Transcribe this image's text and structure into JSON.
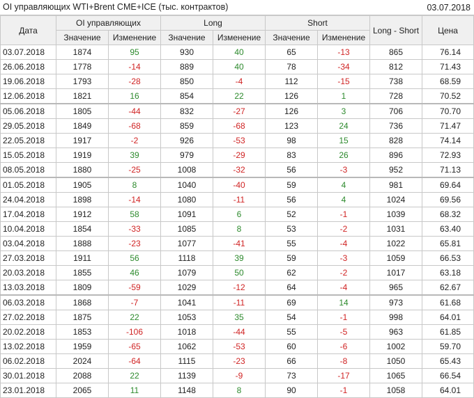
{
  "header": {
    "title": "OI управляющих WTI+Brent CME+ICE (тыс. контрактов)",
    "date": "03.07.2018"
  },
  "columns": {
    "date": "Дата",
    "oi_group": "OI управляющих",
    "long_group": "Long",
    "short_group": "Short",
    "value": "Значение",
    "change": "Изменение",
    "long_short": "Long - Short",
    "price": "Цена"
  },
  "colors": {
    "positive": "#2d8a2d",
    "negative": "#d02424"
  },
  "rows": [
    {
      "date": "03.07.2018",
      "oi": "1874",
      "oi_chg": "95",
      "long": "930",
      "long_chg": "40",
      "short": "65",
      "short_chg": "-13",
      "ls": "865",
      "price": "76.14"
    },
    {
      "date": "26.06.2018",
      "oi": "1778",
      "oi_chg": "-14",
      "long": "889",
      "long_chg": "40",
      "short": "78",
      "short_chg": "-34",
      "ls": "812",
      "price": "71.43"
    },
    {
      "date": "19.06.2018",
      "oi": "1793",
      "oi_chg": "-28",
      "long": "850",
      "long_chg": "-4",
      "short": "112",
      "short_chg": "-15",
      "ls": "738",
      "price": "68.59"
    },
    {
      "date": "12.06.2018",
      "oi": "1821",
      "oi_chg": "16",
      "long": "854",
      "long_chg": "22",
      "short": "126",
      "short_chg": "1",
      "ls": "728",
      "price": "70.52"
    },
    {
      "date": "05.06.2018",
      "oi": "1805",
      "oi_chg": "-44",
      "long": "832",
      "long_chg": "-27",
      "short": "126",
      "short_chg": "3",
      "ls": "706",
      "price": "70.70",
      "sep": true
    },
    {
      "date": "29.05.2018",
      "oi": "1849",
      "oi_chg": "-68",
      "long": "859",
      "long_chg": "-68",
      "short": "123",
      "short_chg": "24",
      "ls": "736",
      "price": "71.47"
    },
    {
      "date": "22.05.2018",
      "oi": "1917",
      "oi_chg": "-2",
      "long": "926",
      "long_chg": "-53",
      "short": "98",
      "short_chg": "15",
      "ls": "828",
      "price": "74.14"
    },
    {
      "date": "15.05.2018",
      "oi": "1919",
      "oi_chg": "39",
      "long": "979",
      "long_chg": "-29",
      "short": "83",
      "short_chg": "26",
      "ls": "896",
      "price": "72.93"
    },
    {
      "date": "08.05.2018",
      "oi": "1880",
      "oi_chg": "-25",
      "long": "1008",
      "long_chg": "-32",
      "short": "56",
      "short_chg": "-3",
      "ls": "952",
      "price": "71.13"
    },
    {
      "date": "01.05.2018",
      "oi": "1905",
      "oi_chg": "8",
      "long": "1040",
      "long_chg": "-40",
      "short": "59",
      "short_chg": "4",
      "ls": "981",
      "price": "69.64",
      "sep": true
    },
    {
      "date": "24.04.2018",
      "oi": "1898",
      "oi_chg": "-14",
      "long": "1080",
      "long_chg": "-11",
      "short": "56",
      "short_chg": "4",
      "ls": "1024",
      "price": "69.56"
    },
    {
      "date": "17.04.2018",
      "oi": "1912",
      "oi_chg": "58",
      "long": "1091",
      "long_chg": "6",
      "short": "52",
      "short_chg": "-1",
      "ls": "1039",
      "price": "68.32"
    },
    {
      "date": "10.04.2018",
      "oi": "1854",
      "oi_chg": "-33",
      "long": "1085",
      "long_chg": "8",
      "short": "53",
      "short_chg": "-2",
      "ls": "1031",
      "price": "63.40"
    },
    {
      "date": "03.04.2018",
      "oi": "1888",
      "oi_chg": "-23",
      "long": "1077",
      "long_chg": "-41",
      "short": "55",
      "short_chg": "-4",
      "ls": "1022",
      "price": "65.81"
    },
    {
      "date": "27.03.2018",
      "oi": "1911",
      "oi_chg": "56",
      "long": "1118",
      "long_chg": "39",
      "short": "59",
      "short_chg": "-3",
      "ls": "1059",
      "price": "66.53"
    },
    {
      "date": "20.03.2018",
      "oi": "1855",
      "oi_chg": "46",
      "long": "1079",
      "long_chg": "50",
      "short": "62",
      "short_chg": "-2",
      "ls": "1017",
      "price": "63.18"
    },
    {
      "date": "13.03.2018",
      "oi": "1809",
      "oi_chg": "-59",
      "long": "1029",
      "long_chg": "-12",
      "short": "64",
      "short_chg": "-4",
      "ls": "965",
      "price": "62.67"
    },
    {
      "date": "06.03.2018",
      "oi": "1868",
      "oi_chg": "-7",
      "long": "1041",
      "long_chg": "-11",
      "short": "69",
      "short_chg": "14",
      "ls": "973",
      "price": "61.68",
      "sep": true
    },
    {
      "date": "27.02.2018",
      "oi": "1875",
      "oi_chg": "22",
      "long": "1053",
      "long_chg": "35",
      "short": "54",
      "short_chg": "-1",
      "ls": "998",
      "price": "64.01"
    },
    {
      "date": "20.02.2018",
      "oi": "1853",
      "oi_chg": "-106",
      "long": "1018",
      "long_chg": "-44",
      "short": "55",
      "short_chg": "-5",
      "ls": "963",
      "price": "61.85"
    },
    {
      "date": "13.02.2018",
      "oi": "1959",
      "oi_chg": "-65",
      "long": "1062",
      "long_chg": "-53",
      "short": "60",
      "short_chg": "-6",
      "ls": "1002",
      "price": "59.70"
    },
    {
      "date": "06.02.2018",
      "oi": "2024",
      "oi_chg": "-64",
      "long": "1115",
      "long_chg": "-23",
      "short": "66",
      "short_chg": "-8",
      "ls": "1050",
      "price": "65.43"
    },
    {
      "date": "30.01.2018",
      "oi": "2088",
      "oi_chg": "22",
      "long": "1139",
      "long_chg": "-9",
      "short": "73",
      "short_chg": "-17",
      "ls": "1065",
      "price": "66.54"
    },
    {
      "date": "23.01.2018",
      "oi": "2065",
      "oi_chg": "11",
      "long": "1148",
      "long_chg": "8",
      "short": "90",
      "short_chg": "-1",
      "ls": "1058",
      "price": "64.01"
    }
  ]
}
